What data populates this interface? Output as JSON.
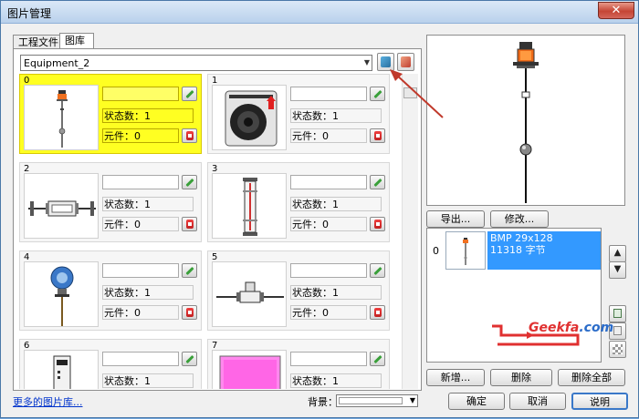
{
  "window": {
    "title": "图片管理",
    "close_glyph": "✕"
  },
  "tabs": [
    {
      "label": "工程文件"
    },
    {
      "label": "图库"
    }
  ],
  "library": {
    "selected": "Equipment_2"
  },
  "toolbar": {
    "import_icon": "import-image-icon",
    "delete_icon": "remove-image-icon"
  },
  "cards": [
    {
      "index": "0",
      "name": "",
      "states_label": "状态数：1",
      "elements_label": "元件：0",
      "selected": true,
      "image": "level-transmitter-icon"
    },
    {
      "index": "1",
      "name": "",
      "states_label": "状态数：1",
      "elements_label": "元件：0",
      "selected": false,
      "image": "speaker-icon"
    },
    {
      "index": "2",
      "name": "",
      "states_label": "状态数：1",
      "elements_label": "元件：0",
      "selected": false,
      "image": "flowmeter-icon"
    },
    {
      "index": "3",
      "name": "",
      "states_label": "状态数：1",
      "elements_label": "元件：0",
      "selected": false,
      "image": "sight-glass-icon"
    },
    {
      "index": "4",
      "name": "",
      "states_label": "状态数：1",
      "elements_label": "元件：0",
      "selected": false,
      "image": "pressure-transmitter-icon"
    },
    {
      "index": "5",
      "name": "",
      "states_label": "状态数：1",
      "elements_label": "元件：0",
      "selected": false,
      "image": "inline-valve-icon"
    },
    {
      "index": "6",
      "name": "",
      "states_label": "状态数：1",
      "elements_label": "",
      "selected": false,
      "image": "controller-icon"
    },
    {
      "index": "7",
      "name": "",
      "states_label": "状态数：1",
      "elements_label": "",
      "selected": false,
      "image": "pink-panel-icon"
    }
  ],
  "footer": {
    "more_link": "更多的图片库...",
    "bg_label": "背景：",
    "bg_color": "#ffffff"
  },
  "preview": {
    "export_label": "导出...",
    "modify_label": "修改..."
  },
  "states": [
    {
      "index": "0",
      "format": "BMP 29x128",
      "size": "11318 字节"
    }
  ],
  "side_buttons": {
    "up": "▲",
    "down": "▼"
  },
  "state_actions": {
    "add_label": "新增...",
    "delete_label": "删除",
    "delete_all_label": "删除全部"
  },
  "dialog": {
    "ok_label": "确定",
    "cancel_label": "取消",
    "help_label": "说明"
  },
  "watermark": {
    "brand": "Geekfa",
    "tld": ".com"
  },
  "colors": {
    "selected_card": "#ffff22",
    "state_highlight": "#3399ff",
    "annotation_arrow": "#c0392b"
  }
}
